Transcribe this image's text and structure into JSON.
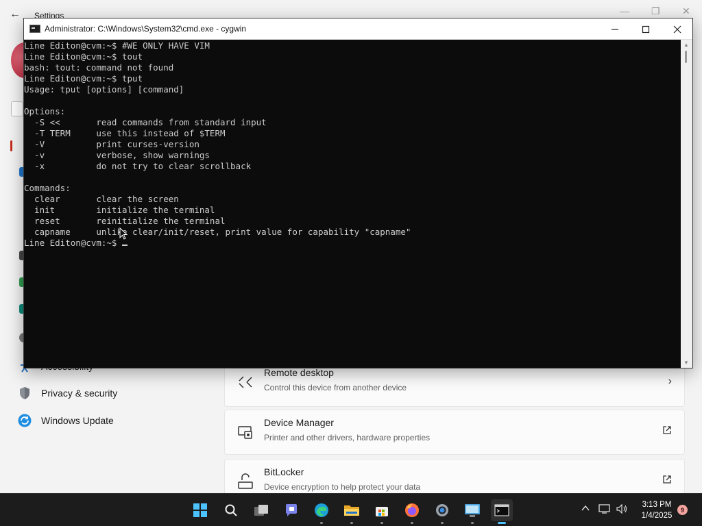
{
  "settings": {
    "window_title": "Settings",
    "nav_items": [
      {
        "label": "Accessibility",
        "icon": "accessibility-icon"
      },
      {
        "label": "Privacy & security",
        "icon": "shield-icon"
      },
      {
        "label": "Windows Update",
        "icon": "windows-update-icon"
      }
    ],
    "cards": [
      {
        "title": "Remote desktop",
        "subtitle": "Control this device from another device",
        "action": "chevron-right-icon"
      },
      {
        "title": "Device Manager",
        "subtitle": "Printer and other drivers, hardware properties",
        "action": "external-link-icon"
      },
      {
        "title": "BitLocker",
        "subtitle": "Device encryption to help protect your data",
        "action": "external-link-icon"
      }
    ]
  },
  "cmd": {
    "title": "Administrator: C:\\Windows\\System32\\cmd.exe - cygwin",
    "lines": [
      "Line Editon@cvm:~$ #WE ONLY HAVE VIM",
      "Line Editon@cvm:~$ tout",
      "bash: tout: command not found",
      "Line Editon@cvm:~$ tput",
      "Usage: tput [options] [command]",
      "",
      "Options:",
      "  -S <<       read commands from standard input",
      "  -T TERM     use this instead of $TERM",
      "  -V          print curses-version",
      "  -v          verbose, show warnings",
      "  -x          do not try to clear scrollback",
      "",
      "Commands:",
      "  clear       clear the screen",
      "  init        initialize the terminal",
      "  reset       reinitialize the terminal",
      "  capname     unlike clear/init/reset, print value for capability \"capname\""
    ],
    "prompt": "Line Editon@cvm:~$ "
  },
  "taskbar": {
    "apps": [
      {
        "name": "start-button",
        "icon": "windows-logo-icon"
      },
      {
        "name": "search-button",
        "icon": "search-icon"
      },
      {
        "name": "task-view-button",
        "icon": "task-view-icon"
      },
      {
        "name": "chat-button",
        "icon": "chat-icon"
      },
      {
        "name": "edge-button",
        "icon": "edge-icon"
      },
      {
        "name": "file-explorer-button",
        "icon": "folder-icon"
      },
      {
        "name": "store-button",
        "icon": "store-icon"
      },
      {
        "name": "firefox-button",
        "icon": "firefox-icon"
      },
      {
        "name": "settings-button",
        "icon": "gear-icon"
      },
      {
        "name": "control-panel-button",
        "icon": "control-panel-icon"
      },
      {
        "name": "terminal-button",
        "icon": "terminal-icon"
      }
    ],
    "time": "3:13 PM",
    "date": "1/4/2025",
    "notification_count": "9"
  }
}
